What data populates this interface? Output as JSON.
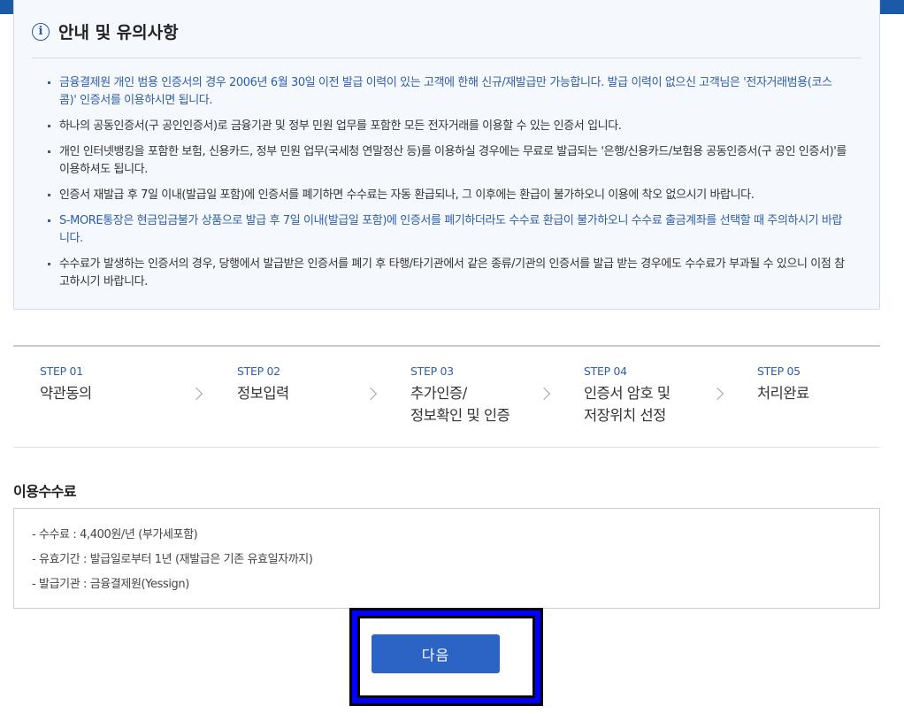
{
  "notice": {
    "title": "안내 및 유의사항",
    "items": [
      {
        "text": "금융결제원 개인 범용 인증서의 경우 2006년 6월 30일 이전 발급 이력이 있는 고객에 한해 신규/재발급만 가능합니다. 발급 이력이 없으신 고객님은 '전자거래범용(코스콤)' 인증서를 이용하시면 됩니다.",
        "highlighted": true
      },
      {
        "text": "하나의 공동인증서(구 공인인증서)로 금융기관 및 정부 민원 업무를 포함한 모든 전자거래를 이용할 수 있는 인증서 입니다.",
        "highlighted": false
      },
      {
        "text": "개인 인터넷뱅킹을 포함한 보험, 신용카드, 정부 민원 업무(국세청 연말정산 등)를 이용하실 경우에는 무료로 발급되는 '은행/신용카드/보험용 공동인증서(구 공인 인증서)'를 이용하셔도 됩니다.",
        "highlighted": false
      },
      {
        "text": "인증서 재발급 후 7일 이내(발급일 포함)에 인증서를 폐기하면 수수료는 자동 환급되나, 그 이후에는 환급이 불가하오니 이용에 착오 없으시기 바랍니다.",
        "highlighted": false
      },
      {
        "text": "S-MORE통장은 현금입금불가 상품으로 발급 후 7일 이내(발급일 포함)에 인증서를 폐기하더라도 수수료 환급이 불가하오니 수수료 출금계좌를 선택할 때 주의하시기 바랍니다.",
        "highlighted": true
      },
      {
        "text": "수수료가 발생하는 인증서의 경우, 당행에서 발급받은 인증서를 폐기 후 타행/타기관에서 같은 종류/기관의 인증서를 발급 받는 경우에도 수수료가 부과될 수 있으니 이점 참고하시기 바랍니다.",
        "highlighted": false
      }
    ]
  },
  "steps": [
    {
      "num": "STEP 01",
      "label": "약관동의"
    },
    {
      "num": "STEP 02",
      "label": "정보입력"
    },
    {
      "num": "STEP 03",
      "label": "추가인증/\n정보확인 및 인증"
    },
    {
      "num": "STEP 04",
      "label": "인증서 암호 및\n저장위치 선정"
    },
    {
      "num": "STEP 05",
      "label": "처리완료"
    }
  ],
  "fee": {
    "title": "이용수수료",
    "items": [
      "- 수수료 : 4,400원/년 (부가세포함)",
      "- 유효기간 : 발급일로부터 1년 (재발급은 기존 유효일자까지)",
      "- 발급기관 : 금융결제원(Yessign)"
    ]
  },
  "next_button": {
    "label": "다음"
  },
  "colors": {
    "topbar": "#1b5aa7",
    "accent": "#2e5ea8",
    "button": "#2b64c4",
    "highlight_box": "#0000ff"
  }
}
